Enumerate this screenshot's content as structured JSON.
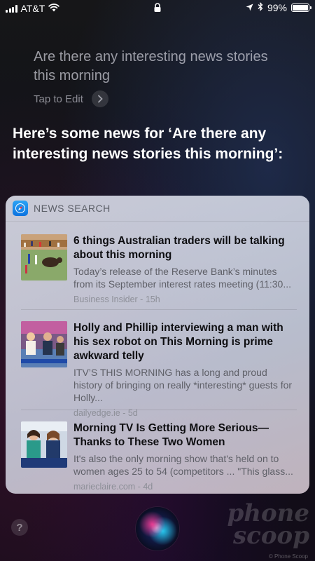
{
  "status_bar": {
    "carrier": "AT&T",
    "battery_percent": "99%",
    "battery_level": 0.99,
    "icons": [
      "cellular-signal-icon",
      "wifi-icon",
      "lock-icon",
      "location-icon",
      "bluetooth-icon",
      "battery-icon"
    ]
  },
  "siri": {
    "query": "Are there any interesting news stories this morning",
    "tap_to_edit": "Tap to Edit",
    "response": "Here’s some news for ‘Are there any interesting news stories this morning’:"
  },
  "card": {
    "title": "NEWS SEARCH",
    "icon": "safari-compass-icon",
    "items": [
      {
        "headline": "6 things Australian traders will be talking about this morning",
        "snippet": "Today’s release of the Reserve Bank’s minutes from its September interest rates meeting (11:30...",
        "source": "Business Insider - 15h",
        "thumb_icon": "news-thumbnail-stampede"
      },
      {
        "headline": "Holly and Phillip interviewing a man with his sex robot on This Morning is prime awkward telly",
        "snippet": "ITV’S THIS MORNING has a long and proud history of bringing on really *interesting* guests for Holly...",
        "source": "dailyedge.ie - 5d",
        "thumb_icon": "news-thumbnail-tv-studio"
      },
      {
        "headline": "Morning TV Is Getting More Serious—Thanks to These Two Women",
        "snippet": "It's also the only morning show that's held on to women ages 25 to 54 (competitors ... \"This glass...",
        "source": "marieclaire.com - 4d",
        "thumb_icon": "news-thumbnail-anchors"
      }
    ]
  },
  "bottom": {
    "help_label": "?",
    "watermark_line1": "phone",
    "watermark_line2": "scoop",
    "watermark_small": "© Phone Scoop"
  },
  "colors": {
    "card_background": "#dfe2ee",
    "headline": "#0d0d10",
    "snippet": "#5f6068",
    "source": "#8d8f98",
    "query_text": "#a9a9b2"
  }
}
